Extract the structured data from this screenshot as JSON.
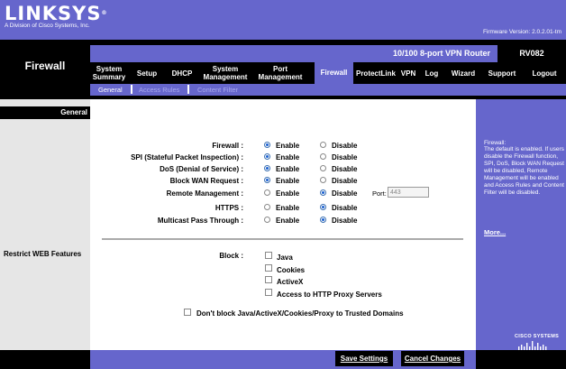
{
  "header": {
    "logo": "LINKSYS",
    "logo_mark": "®",
    "logo_sub": "A Division of Cisco Systems, Inc.",
    "firmware": "Firmware Version: 2.0.2.01-tm"
  },
  "page_title": "Firewall",
  "router_name": "10/100 8-port VPN Router",
  "model": "RV082",
  "nav": [
    {
      "line1": "System",
      "line2": "Summary"
    },
    {
      "line1": "Setup",
      "line2": ""
    },
    {
      "line1": "DHCP",
      "line2": ""
    },
    {
      "line1": "System",
      "line2": "Management"
    },
    {
      "line1": "Port",
      "line2": "Management"
    },
    {
      "line1": "Firewall",
      "line2": ""
    },
    {
      "line1": "ProtectLink",
      "line2": ""
    },
    {
      "line1": "VPN",
      "line2": ""
    },
    {
      "line1": "Log",
      "line2": ""
    },
    {
      "line1": "Wizard",
      "line2": ""
    },
    {
      "line1": "Support",
      "line2": ""
    },
    {
      "line1": "Logout",
      "line2": ""
    }
  ],
  "subnav": [
    "General",
    "Access Rules",
    "Content Filter"
  ],
  "left": {
    "section_general": "General",
    "section_restrict": "Restrict WEB Features"
  },
  "settings": [
    {
      "label": "Firewall :",
      "selected": "Enable"
    },
    {
      "label": "SPI (Stateful Packet Inspection) :",
      "selected": "Enable"
    },
    {
      "label": "DoS (Denial of Service) :",
      "selected": "Enable"
    },
    {
      "label": "Block WAN Request :",
      "selected": "Enable"
    },
    {
      "label": "Remote Management :",
      "selected": "Disable"
    },
    {
      "label": "HTTPS :",
      "selected": "Disable"
    },
    {
      "label": "Multicast Pass Through :",
      "selected": "Disable"
    }
  ],
  "options": {
    "enable": "Enable",
    "disable": "Disable"
  },
  "port": {
    "label": "Port:",
    "value": "443"
  },
  "block": {
    "label": "Block :",
    "items": [
      "Java",
      "Cookies",
      "ActiveX",
      "Access to HTTP Proxy Servers"
    ],
    "trusted": "Don't block Java/ActiveX/Cookies/Proxy to Trusted Domains"
  },
  "help": {
    "heading": "Firewall:",
    "text": "The default is enabled. If users disable the Firewall function, SPI, DoS, Block WAN Request will be disabled, Remote Management will be enabled and Access Rules and Content Filter will be disabled.",
    "more": "More..."
  },
  "cisco": "CISCO SYSTEMS",
  "buttons": {
    "save": "Save Settings",
    "cancel": "Cancel Changes"
  },
  "colors": {
    "brand": "#6666cc",
    "black": "#000000",
    "panel": "#e6e6e6"
  }
}
